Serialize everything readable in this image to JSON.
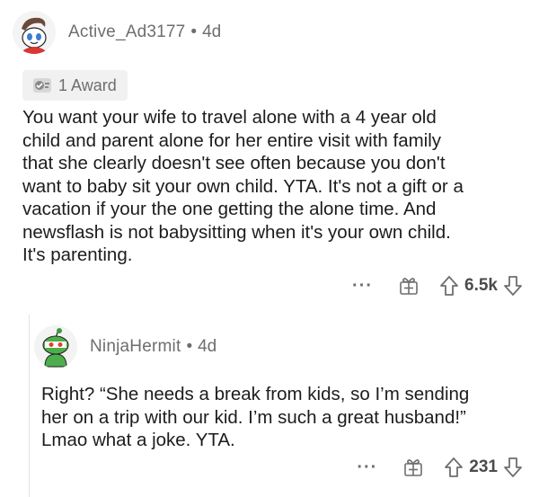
{
  "comments": [
    {
      "username": "Active_Ad3177",
      "separator": "•",
      "age": "4d",
      "avatar_icon": "snoo-avatar-icon",
      "award": {
        "icon": "award-icon",
        "label": "1 Award"
      },
      "body": "You want your wife to travel alone with a 4 year old\nchild and parent alone for her entire visit with family\nthat she clearly doesn't see often because you don't\nwant to baby sit your own child. YTA. It's not a gift or a\nvacation if your the one getting the alone time. And\nnewsflash is not babysitting when it's your own child.\nIt's parenting.",
      "actions": {
        "more": "···",
        "gift_icon": "gift-icon",
        "upvote_icon": "arrow-up-icon",
        "votes": "6.5k",
        "downvote_icon": "arrow-down-icon"
      }
    },
    {
      "username": "NinjaHermit",
      "separator": "•",
      "age": "4d",
      "avatar_icon": "snoo-avatar-icon",
      "body": "Right? “She needs a break from kids, so I’m sending\nher on a trip with our kid. I’m such a great husband!”\nLmao what a joke. YTA.",
      "actions": {
        "more": "···",
        "gift_icon": "gift-icon",
        "upvote_icon": "arrow-up-icon",
        "votes": "231",
        "downvote_icon": "arrow-down-icon"
      }
    }
  ],
  "colors": {
    "meta": "#6c6e70",
    "text": "#1c1c1c",
    "award_bg": "#f1f1f1"
  }
}
